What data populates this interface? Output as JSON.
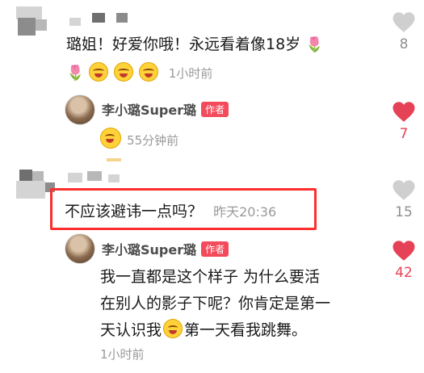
{
  "comment1": {
    "text": "璐姐！好爱你哦！永远看着像18岁",
    "time": "1小时前",
    "likes": "8",
    "reply": {
      "author": "李小璐Super璐",
      "badge": "作者",
      "time": "55分钟前",
      "likes": "7"
    }
  },
  "comment2": {
    "text": "不应该避讳一点吗？",
    "time": "昨天20:36",
    "likes": "15",
    "reply": {
      "author": "李小璐Super璐",
      "badge": "作者",
      "text_line1": "我一直都是这个样子 为什么要活",
      "text_line2": "在别人的影子下呢？你肯定是第一",
      "text_line3a": "天认识我",
      "text_line3b": "第一天看我跳舞。",
      "time": "1小时前",
      "likes": "42"
    }
  },
  "colors": {
    "liked": "#e64257",
    "unliked": "#cfcfcf",
    "author_badge": "#f44b5c",
    "highlight": "#ff2e2e"
  },
  "icons": {
    "like_unliked": "heart-outline-icon",
    "like_liked": "heart-filled-icon",
    "rose": "rose-icon",
    "emoji": "grinning-emoji-icon"
  }
}
